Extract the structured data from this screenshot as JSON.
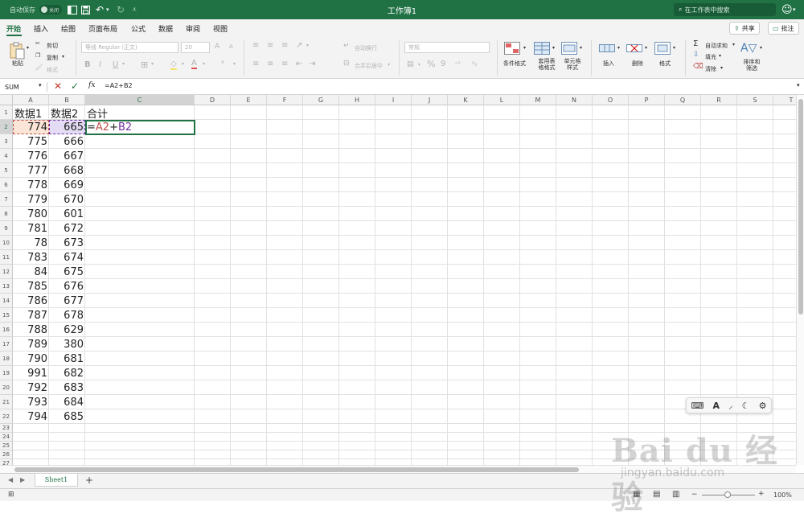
{
  "titlebar": {
    "autosave_label": "自动保存",
    "autosave_state": "关闭",
    "workbook_title": "工作簿1",
    "search_placeholder": "在工作表中搜索",
    "accent_color": "#207245"
  },
  "ribbon_tabs": [
    "开始",
    "插入",
    "绘图",
    "页面布局",
    "公式",
    "数据",
    "审阅",
    "视图"
  ],
  "active_tab": "开始",
  "share_label": "共享",
  "comment_label": "批注",
  "ribbon": {
    "paste_label": "粘贴",
    "cut_label": "剪切",
    "copy_label": "复制",
    "format_painter_label": "格式",
    "font_name": "等线 Regular (正文)",
    "font_size": "20",
    "wrap_text_label": "自动换行",
    "merge_label": "合并后居中",
    "number_format": "常规",
    "cond_format_label": "条件格式",
    "table_format_label": "套用表格格式",
    "cell_style_label": "单元格样式",
    "insert_label": "插入",
    "delete_label": "删除",
    "format_label": "格式",
    "autosum_label": "自动求和",
    "fill_label": "填充",
    "clear_label": "清除",
    "sort_filter_label": "排序和筛选",
    "bold": "B",
    "italic": "I",
    "underline": "U",
    "font_grow": "A",
    "font_shrink": "A",
    "font_color_letter": "A",
    "percent": "%",
    "comma": "9"
  },
  "formula_bar": {
    "name_box": "SUM",
    "fx_label": "fx",
    "formula": "=A2+B2"
  },
  "columns": [
    "A",
    "B",
    "C",
    "D",
    "E",
    "F",
    "G",
    "H",
    "I",
    "J",
    "K",
    "L",
    "M",
    "N",
    "O",
    "P",
    "Q",
    "R",
    "S",
    "T"
  ],
  "rows": [
    "1",
    "2",
    "3",
    "4",
    "5",
    "6",
    "7",
    "8",
    "9",
    "10",
    "11",
    "12",
    "13",
    "14",
    "15",
    "16",
    "17",
    "18",
    "19",
    "20",
    "21",
    "22",
    "23",
    "24",
    "25",
    "26",
    "27"
  ],
  "cells": {
    "header_a": "数据1",
    "header_b": "数据2",
    "header_c": "合计",
    "col_a": [
      "774",
      "775",
      "776",
      "777",
      "778",
      "779",
      "780",
      "781",
      "78",
      "783",
      "84",
      "785",
      "786",
      "787",
      "788",
      "789",
      "790",
      "991",
      "792",
      "793",
      "794"
    ],
    "col_b": [
      "665",
      "666",
      "667",
      "668",
      "669",
      "670",
      "601",
      "672",
      "673",
      "674",
      "675",
      "676",
      "677",
      "678",
      "629",
      "380",
      "681",
      "682",
      "683",
      "684",
      "685"
    ],
    "c2_eq": "=",
    "c2_ref_a": "A2",
    "c2_plus": "+",
    "c2_ref_b": "B2",
    "ref_a_color": "#c0504d",
    "ref_b_color": "#7030a0"
  },
  "sheet_tab": "Sheet1",
  "add_sheet_label": "+",
  "zoom_label": "100%",
  "watermark": {
    "logo": "Bai du 经验",
    "url": "jingyan.baidu.com"
  }
}
